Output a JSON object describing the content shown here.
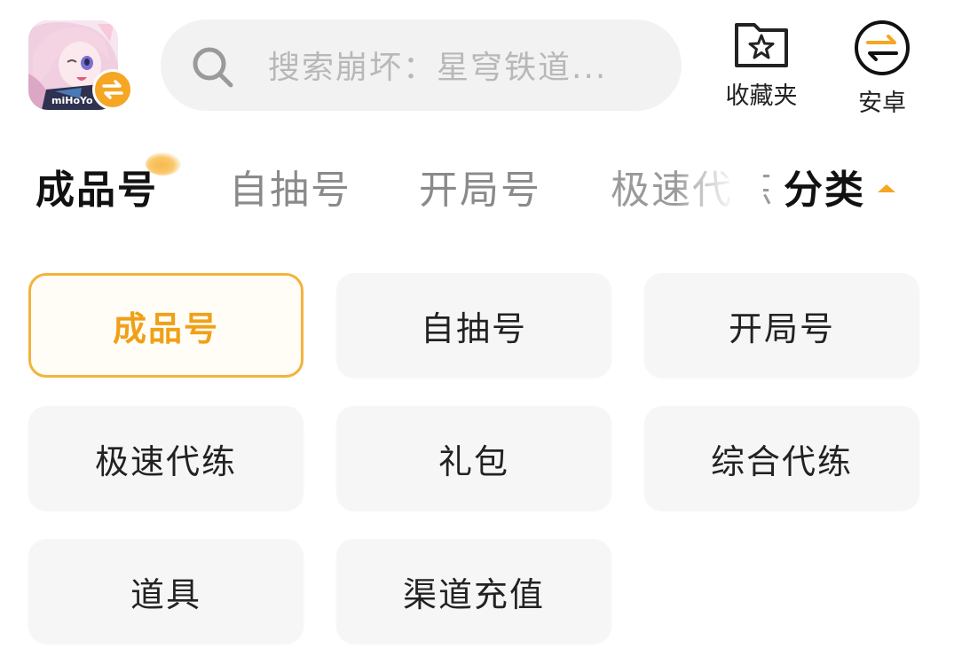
{
  "header": {
    "app_icon_name": "app-icon",
    "app_logo_text": "miHoYo",
    "search": {
      "placeholder": "搜索崩坏：星穹铁道..."
    },
    "favorites_label": "收藏夹",
    "platform_label": "安卓"
  },
  "tabs": [
    {
      "label": "成品号",
      "active": true
    },
    {
      "label": "自抽号",
      "active": false
    },
    {
      "label": "开局号",
      "active": false
    },
    {
      "label": "极速代练",
      "active": false
    }
  ],
  "category_toggle": {
    "label": "分类",
    "icon": "caret-up-icon"
  },
  "categories": [
    {
      "label": "成品号",
      "selected": true
    },
    {
      "label": "自抽号",
      "selected": false
    },
    {
      "label": "开局号",
      "selected": false
    },
    {
      "label": "极速代练",
      "selected": false
    },
    {
      "label": "礼包",
      "selected": false
    },
    {
      "label": "综合代练",
      "selected": false
    },
    {
      "label": "道具",
      "selected": false
    },
    {
      "label": "渠道充值",
      "selected": false
    }
  ],
  "colors": {
    "accent": "#f5a623",
    "selected_text": "#f0a018",
    "search_bg": "#f2f2f2",
    "chip_bg": "#f6f6f6"
  }
}
